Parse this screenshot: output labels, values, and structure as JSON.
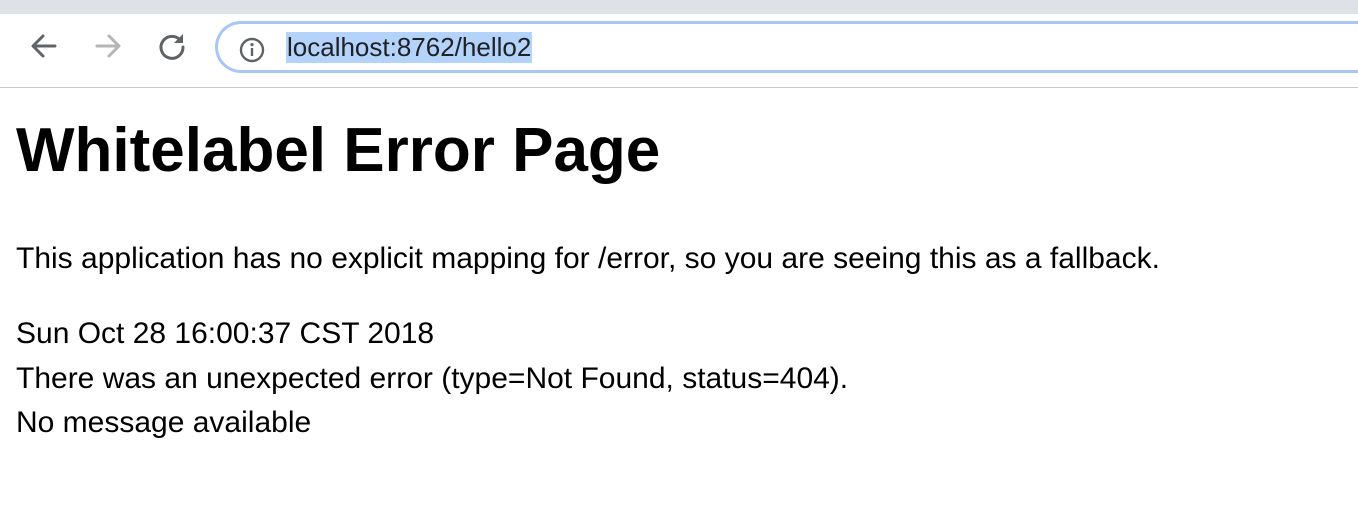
{
  "browser": {
    "url": "localhost:8762/hello2"
  },
  "page": {
    "title": "Whitelabel Error Page",
    "description": "This application has no explicit mapping for /error, so you are seeing this as a fallback.",
    "timestamp": "Sun Oct 28 16:00:37 CST 2018",
    "error_text": "There was an unexpected error (type=Not Found, status=404).",
    "message": "No message available"
  },
  "icons": {
    "back": "arrow-left-icon",
    "forward": "arrow-right-icon",
    "reload": "reload-icon",
    "site_info": "info-circle-icon"
  },
  "colors": {
    "tabstrip": "#dee1e6",
    "omnibox_border": "#a8c7f5",
    "url_selection": "#b3d3fb",
    "forward_disabled": "#b5b5b5"
  }
}
